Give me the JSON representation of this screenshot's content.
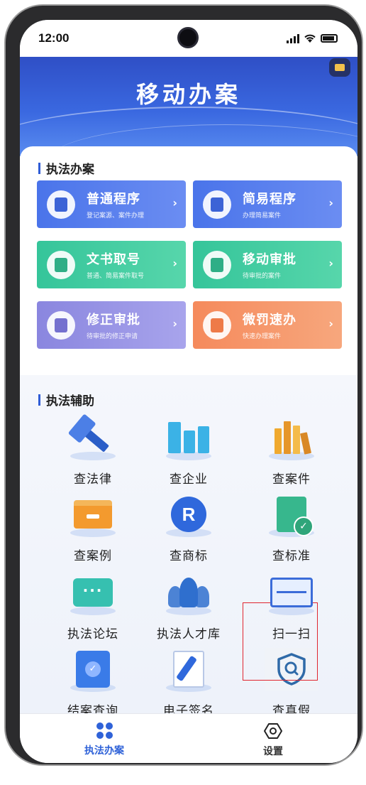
{
  "status_bar": {
    "time": "12:00"
  },
  "header": {
    "title": "移动办案"
  },
  "law_enforcement_case": {
    "title": "执法办案",
    "cards": [
      {
        "title": "普通程序",
        "subtitle": "登记案源、案件办理",
        "color": "#4a74ea",
        "icon": "document-edit-icon"
      },
      {
        "title": "简易程序",
        "subtitle": "办理简易案件",
        "color": "#4a74ea",
        "icon": "document-stamp-icon"
      },
      {
        "title": "文书取号",
        "subtitle": "普通、简易案件取号",
        "color": "#35c59a",
        "icon": "printer-icon"
      },
      {
        "title": "移动审批",
        "subtitle": "待审批的案件",
        "color": "#35c59a",
        "icon": "approval-stamp-icon"
      },
      {
        "title": "修正审批",
        "subtitle": "待审批的修正申请",
        "color": "#8a86df",
        "icon": "edit-form-icon"
      },
      {
        "title": "微罚速办",
        "subtitle": "快速办理案件",
        "color": "#f58a5c",
        "icon": "quick-ticket-icon"
      }
    ]
  },
  "law_enforcement_aid": {
    "title": "执法辅助",
    "tools": [
      {
        "label": "查法律",
        "icon": "gavel-icon"
      },
      {
        "label": "查企业",
        "icon": "building-icon"
      },
      {
        "label": "查案件",
        "icon": "books-icon"
      },
      {
        "label": "查案例",
        "icon": "file-box-icon"
      },
      {
        "label": "查商标",
        "icon": "registered-trademark-icon"
      },
      {
        "label": "查标准",
        "icon": "standard-check-icon"
      },
      {
        "label": "执法论坛",
        "icon": "chat-bubble-icon"
      },
      {
        "label": "执法人才库",
        "icon": "people-icon"
      },
      {
        "label": "扫一扫",
        "icon": "scan-icon"
      },
      {
        "label": "结案查询",
        "icon": "clipboard-check-icon"
      },
      {
        "label": "电子签名",
        "icon": "signature-pen-icon"
      },
      {
        "label": "查真假",
        "icon": "shield-search-icon"
      }
    ]
  },
  "tabbar": {
    "tabs": [
      {
        "label": "执法办案",
        "icon": "grid-dots-icon",
        "active": true
      },
      {
        "label": "设置",
        "icon": "hexagon-settings-icon",
        "active": false
      }
    ]
  },
  "colors": {
    "accent": "#2f62d8",
    "highlight": "#e0262f"
  }
}
